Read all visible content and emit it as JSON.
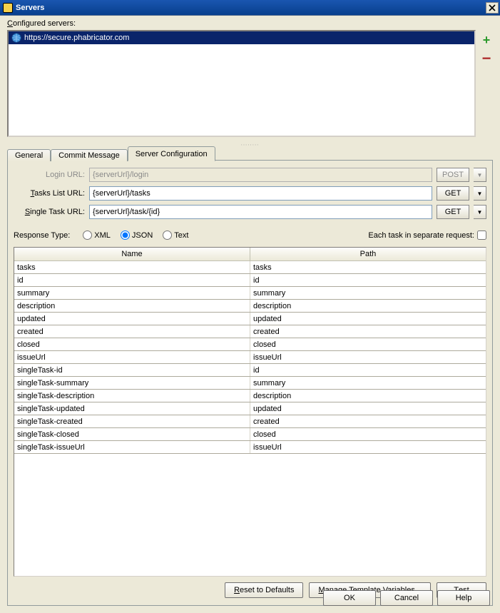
{
  "title": "Servers",
  "configured_label": "Configured servers:",
  "configured_underline": "C",
  "server_item": "https://secure.phabricator.com",
  "tabs": {
    "general": "General",
    "commit": "Commit Message",
    "config": "Server Configuration"
  },
  "form": {
    "login": {
      "label": "Login URL:",
      "value": "{serverUrl}/login",
      "method": "POST",
      "enabled": false
    },
    "tasks": {
      "label": "Tasks List URL:",
      "underline": "T",
      "value": "{serverUrl}/tasks",
      "method": "GET",
      "enabled": true
    },
    "single": {
      "label": "Single Task URL:",
      "underline": "S",
      "value": "{serverUrl}/task/{id}",
      "method": "GET",
      "enabled": true
    }
  },
  "response_type_label": "Response Type:",
  "response_types": {
    "xml": "XML",
    "json": "JSON",
    "text": "Text",
    "xml_ul": "X",
    "json_ul": "O",
    "text_ul": "e"
  },
  "selected_response": "json",
  "separate_label": "Each task in separate request:",
  "separate_checked": false,
  "grid": {
    "columns": [
      "Name",
      "Path"
    ],
    "rows": [
      {
        "name": "tasks",
        "path": "tasks"
      },
      {
        "name": "id",
        "path": "id"
      },
      {
        "name": "summary",
        "path": "summary"
      },
      {
        "name": "description",
        "path": "description"
      },
      {
        "name": "updated",
        "path": "updated"
      },
      {
        "name": "created",
        "path": "created"
      },
      {
        "name": "closed",
        "path": "closed"
      },
      {
        "name": "issueUrl",
        "path": "issueUrl"
      },
      {
        "name": "singleTask-id",
        "path": "id"
      },
      {
        "name": "singleTask-summary",
        "path": "summary"
      },
      {
        "name": "singleTask-description",
        "path": "description"
      },
      {
        "name": "singleTask-updated",
        "path": "updated"
      },
      {
        "name": "singleTask-created",
        "path": "created"
      },
      {
        "name": "singleTask-closed",
        "path": "closed"
      },
      {
        "name": "singleTask-issueUrl",
        "path": "issueUrl"
      }
    ]
  },
  "pane_buttons": {
    "reset": "Reset to Defaults",
    "manage": "Manage Template Variables...",
    "test": "Test"
  },
  "dialog_buttons": {
    "ok": "OK",
    "cancel": "Cancel",
    "help": "Help"
  }
}
